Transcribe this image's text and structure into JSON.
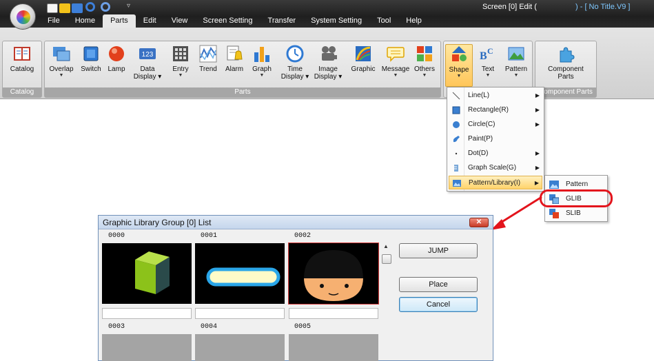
{
  "window": {
    "title_prefix": "Screen [0] Edit (",
    "title_suffix": ") - [ No Title.V9 ]"
  },
  "menu": {
    "items": [
      "File",
      "Home",
      "Parts",
      "Edit",
      "View",
      "Screen Setting",
      "Transfer",
      "System Setting",
      "Tool",
      "Help"
    ],
    "active": "Parts"
  },
  "ribbon": {
    "catalog_group": {
      "label": "Catalog",
      "buttons": [
        "Catalog"
      ]
    },
    "parts_group": {
      "label": "Parts",
      "buttons": [
        {
          "label": "Overlap",
          "sub": "▼",
          "icon": "overlap-icon"
        },
        {
          "label": "Switch",
          "sub": "",
          "icon": "switch-icon"
        },
        {
          "label": "Lamp",
          "sub": "",
          "icon": "lamp-icon"
        },
        {
          "label": "Data\nDisplay ▾",
          "sub": "",
          "icon": "data-display-icon"
        },
        {
          "label": "Entry",
          "sub": "▼",
          "icon": "entry-icon"
        },
        {
          "label": "Trend",
          "sub": "",
          "icon": "trend-icon"
        },
        {
          "label": "Alarm",
          "sub": "",
          "icon": "alarm-icon"
        },
        {
          "label": "Graph",
          "sub": "▼",
          "icon": "graph-icon"
        },
        {
          "label": "Time\nDisplay ▾",
          "sub": "",
          "icon": "time-display-icon"
        },
        {
          "label": "Image\nDisplay ▾",
          "sub": "",
          "icon": "image-display-icon"
        },
        {
          "label": "Graphic",
          "sub": "",
          "icon": "graphic-icon"
        },
        {
          "label": "Message",
          "sub": "▼",
          "icon": "message-icon"
        },
        {
          "label": "Others",
          "sub": "▼",
          "icon": "others-icon"
        }
      ]
    },
    "shape_group": {
      "buttons": [
        {
          "label": "Shape",
          "sub": "▼",
          "icon": "shape-icon"
        },
        {
          "label": "Text",
          "sub": "▼",
          "icon": "text-icon"
        },
        {
          "label": "Pattern",
          "sub": "▼",
          "icon": "pattern-icon"
        }
      ]
    },
    "component_group": {
      "label": "Component Parts",
      "buttons": [
        {
          "label": "Component\nParts",
          "icon": "component-parts-icon"
        }
      ]
    }
  },
  "shape_menu": {
    "items": [
      {
        "label": "Line(L)",
        "icon": "line-icon",
        "has_submenu": true
      },
      {
        "label": "Rectangle(R)",
        "icon": "rectangle-icon",
        "has_submenu": true
      },
      {
        "label": "Circle(C)",
        "icon": "circle-icon",
        "has_submenu": true
      },
      {
        "label": "Paint(P)",
        "icon": "paint-icon",
        "has_submenu": false
      },
      {
        "label": "Dot(D)",
        "icon": "dot-icon",
        "has_submenu": true
      },
      {
        "label": "Graph Scale(G)",
        "icon": "graph-scale-icon",
        "has_submenu": true
      },
      {
        "label": "Pattern/Library(I)",
        "icon": "pattern-library-icon",
        "has_submenu": true,
        "highlighted": true
      }
    ]
  },
  "library_submenu": {
    "items": [
      {
        "label": "Pattern",
        "icon": "pattern-icon"
      },
      {
        "label": "GLIB",
        "icon": "glib-icon",
        "circled": true
      },
      {
        "label": "SLIB",
        "icon": "slib-icon"
      }
    ]
  },
  "dialog": {
    "title": "Graphic Library Group [0] List",
    "close": "✕",
    "thumbnails": [
      {
        "num": "0000",
        "content": "cube"
      },
      {
        "num": "0001",
        "content": "rounded-bar"
      },
      {
        "num": "0002",
        "content": "face",
        "selected": true
      },
      {
        "num": "0003",
        "content": "empty"
      },
      {
        "num": "0004",
        "content": "empty"
      },
      {
        "num": "0005",
        "content": "empty"
      }
    ],
    "buttons": {
      "jump": "JUMP",
      "place": "Place",
      "cancel": "Cancel"
    }
  },
  "colors": {
    "title_bar": "#2a2a2a",
    "ribbon": "#d8d8d8",
    "highlight": "#ffd36a",
    "callout_red": "#e3141c",
    "dialog_title": "#c5d6ec"
  }
}
